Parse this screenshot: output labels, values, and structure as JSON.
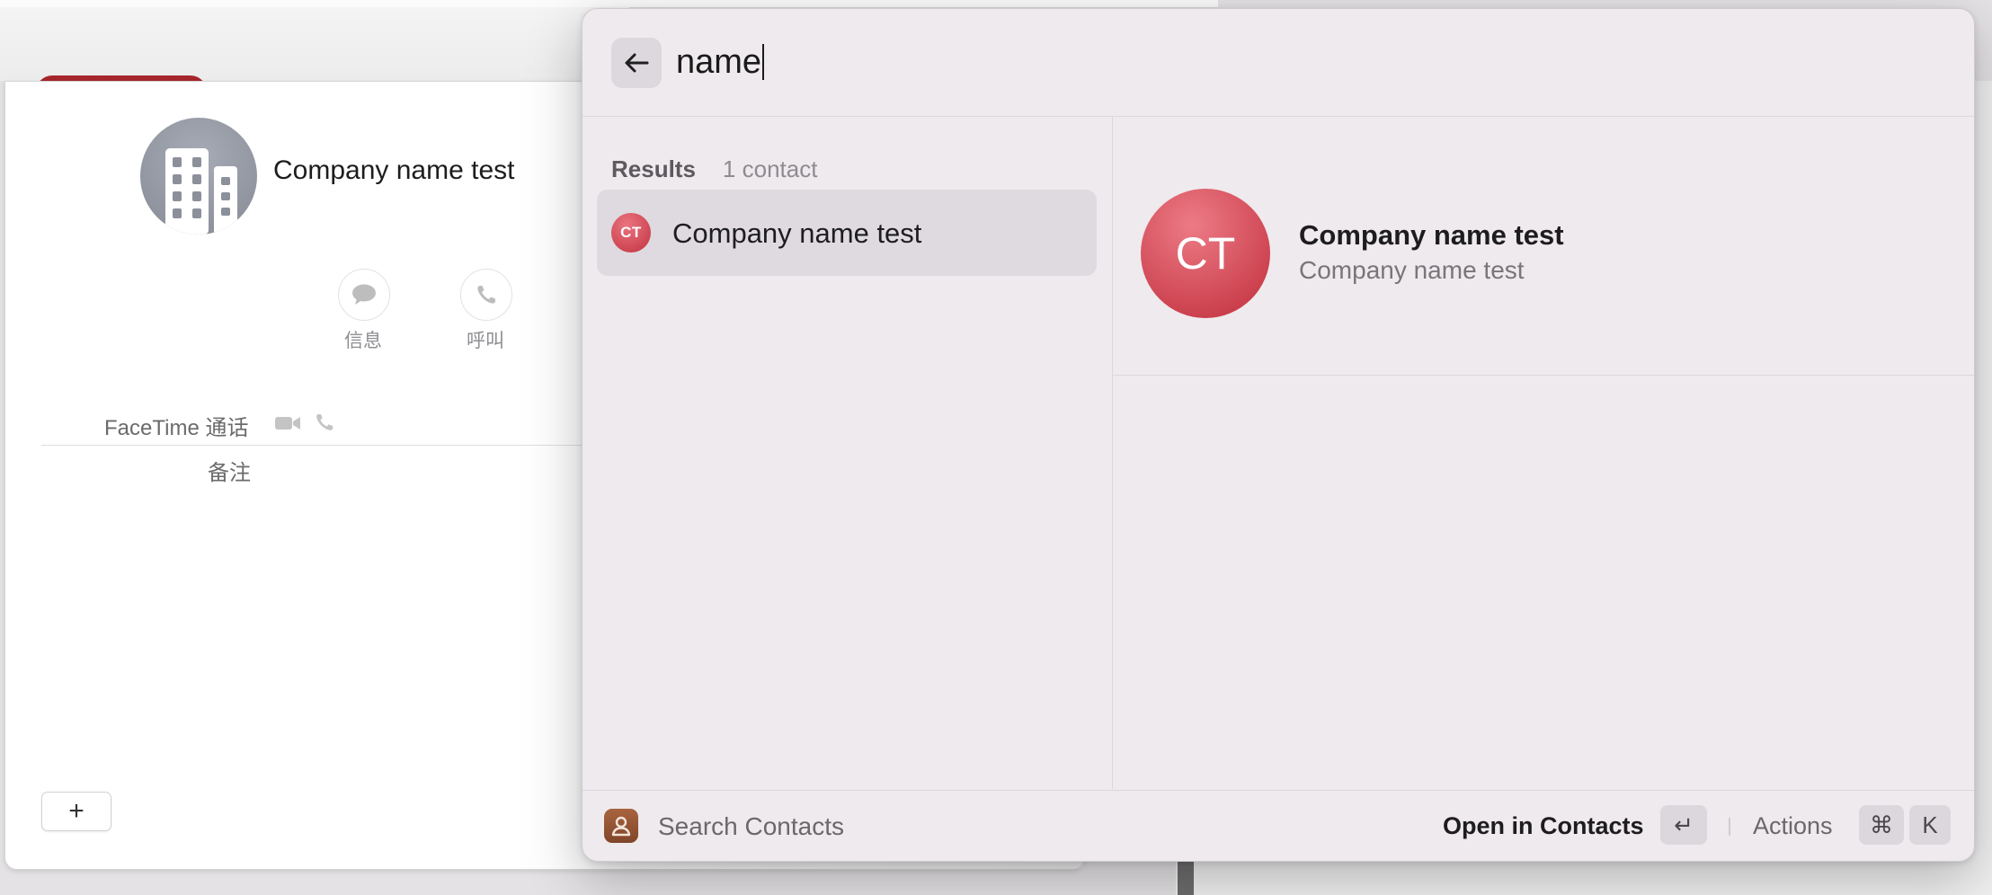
{
  "contact_card": {
    "name": "Company name test",
    "buttons": [
      {
        "label": "信息",
        "icon": "message-icon"
      },
      {
        "label": "呼叫",
        "icon": "phone-icon"
      }
    ],
    "facetime_label": "FaceTime 通话",
    "notes_label": "备注",
    "add_label": "+"
  },
  "search": {
    "query": "name"
  },
  "results": {
    "title": "Results",
    "count": "1 contact",
    "items": [
      {
        "initials": "CT",
        "name": "Company name test"
      }
    ]
  },
  "detail": {
    "initials": "CT",
    "name": "Company name test",
    "company": "Company name test"
  },
  "footer": {
    "title": "Search Contacts",
    "primary_action": "Open in Contacts",
    "enter_key": "↵",
    "actions_label": "Actions",
    "cmd_key": "⌘",
    "k_key": "K"
  },
  "colors": {
    "avatar_red": "#c8343f",
    "panel_bg": "#efeaee",
    "selected_row": "#dfdadf"
  }
}
